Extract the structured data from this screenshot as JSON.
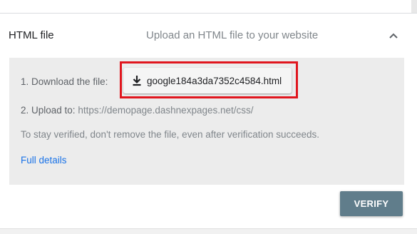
{
  "section": {
    "title": "HTML file",
    "description": "Upload an HTML file to your website",
    "collapse_icon": "chevron-up-icon"
  },
  "steps": {
    "download_label": "1. Download the file:",
    "download_file_name": "google184a3da7352c4584.html",
    "download_icon": "download-icon",
    "upload_prefix": "2. Upload to:",
    "upload_url": "https://demopage.dashnexpages.net/css/"
  },
  "note": "To stay verified, don't remove the file, even after verification succeeds.",
  "details_link": "Full details",
  "verify_button": "VERIFY",
  "colors": {
    "highlight": "#e0161e",
    "link": "#1a73e8",
    "verify_bg": "#607d8b",
    "panel_bg": "#ececec"
  }
}
